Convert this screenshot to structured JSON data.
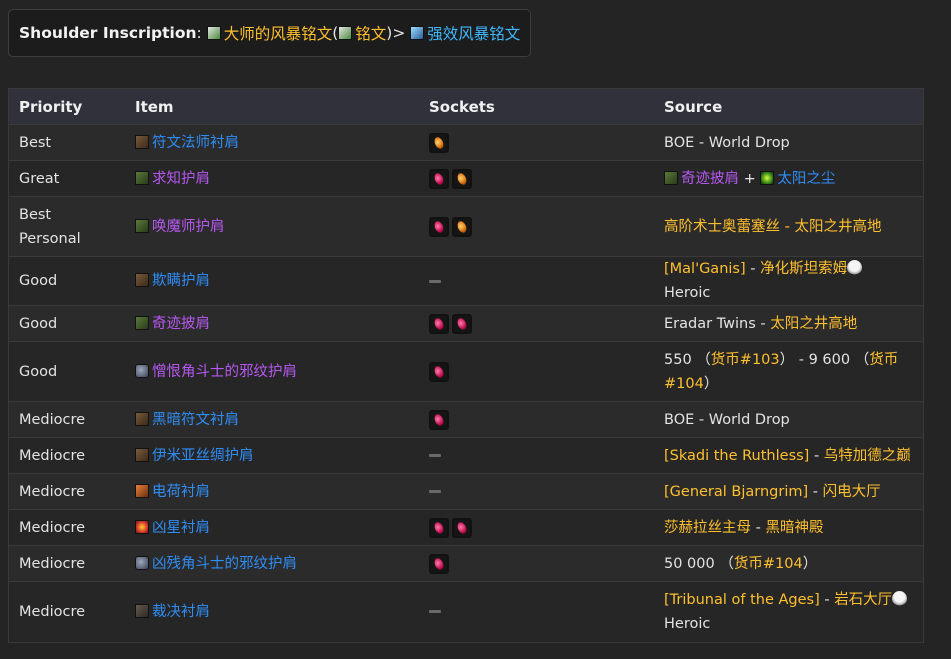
{
  "inscription": {
    "label": "Shoulder Inscription",
    "colon": ":",
    "master_name": "大师的风暴铭文",
    "paren_open": " (",
    "alt_name": "铭文",
    "paren_close": ") ",
    "arrow": ">",
    "upgrade_name": "强效风暴铭文"
  },
  "table": {
    "headers": [
      "Priority",
      "Item",
      "Sockets",
      "Source"
    ],
    "rows": [
      {
        "priority": "Best",
        "item": "符文法师衬肩",
        "item_color": "blue",
        "icon": "shoulder",
        "sockets": [
          "orange"
        ],
        "source": [
          {
            "t": "BOE - World Drop",
            "c": "white"
          }
        ]
      },
      {
        "priority": "Great",
        "item": "求知护肩",
        "item_color": "purple",
        "icon": "shoulder-green",
        "sockets": [
          "red",
          "orange"
        ],
        "source": [
          {
            "t": "奇迹披肩",
            "c": "purple",
            "icon": "shoulder-green"
          },
          {
            "t": " + ",
            "c": "white"
          },
          {
            "t": "太阳之尘",
            "c": "blue",
            "icon": "dust"
          }
        ]
      },
      {
        "priority": "Best Personal",
        "item": "唤魔师护肩",
        "item_color": "purple",
        "icon": "shoulder-green",
        "sockets": [
          "red",
          "orange"
        ],
        "source": [
          {
            "t": "高阶术士奥蕾塞丝 - 太阳之井高地",
            "c": "gold"
          }
        ]
      },
      {
        "priority": "Good",
        "item": "欺瞒护肩",
        "item_color": "blue",
        "icon": "shoulder",
        "sockets": [],
        "source": [
          {
            "t": "[Mal'Ganis]",
            "c": "gold"
          },
          {
            "t": " - ",
            "c": "white"
          },
          {
            "t": "净化斯坦索姆",
            "c": "gold"
          },
          {
            "t": " Heroic",
            "c": "white",
            "icon": "skull"
          }
        ]
      },
      {
        "priority": "Good",
        "item": "奇迹披肩",
        "item_color": "purple",
        "icon": "shoulder-green",
        "sockets": [
          "red",
          "red"
        ],
        "source": [
          {
            "t": "Eradar Twins",
            "c": "white"
          },
          {
            "t": " - ",
            "c": "white"
          },
          {
            "t": "太阳之井高地",
            "c": "gold"
          }
        ]
      },
      {
        "priority": "Good",
        "item": "憎恨角斗士的邪纹护肩",
        "item_color": "purple",
        "icon": "shoulder-felhorn",
        "sockets": [
          "red"
        ],
        "source": [
          {
            "t": "550 （",
            "c": "white"
          },
          {
            "t": "货币#103",
            "c": "gold"
          },
          {
            "t": "） - 9 600 （",
            "c": "white"
          },
          {
            "t": "货币#104",
            "c": "gold"
          },
          {
            "t": "）",
            "c": "white"
          }
        ]
      },
      {
        "priority": "Mediocre",
        "item": "黑暗符文衬肩",
        "item_color": "blue",
        "icon": "shoulder",
        "sockets": [
          "red"
        ],
        "source": [
          {
            "t": "BOE - World Drop",
            "c": "white"
          }
        ]
      },
      {
        "priority": "Mediocre",
        "item": "伊米亚丝绸护肩",
        "item_color": "blue",
        "icon": "shoulder",
        "sockets": [],
        "source": [
          {
            "t": "[Skadi the Ruthless]",
            "c": "gold"
          },
          {
            "t": " - ",
            "c": "white"
          },
          {
            "t": "乌特加德之巅",
            "c": "gold"
          }
        ]
      },
      {
        "priority": "Mediocre",
        "item": "电荷衬肩",
        "item_color": "blue",
        "icon": "shoulder-orange",
        "sockets": [],
        "source": [
          {
            "t": "[General Bjarngrim]",
            "c": "gold"
          },
          {
            "t": " - ",
            "c": "white"
          },
          {
            "t": "闪电大厅",
            "c": "gold"
          }
        ]
      },
      {
        "priority": "Mediocre",
        "item": "凶星衬肩",
        "item_color": "blue",
        "icon": "shoulder-fire",
        "sockets": [
          "red",
          "red"
        ],
        "source": [
          {
            "t": "莎赫拉丝主母",
            "c": "gold"
          },
          {
            "t": " - ",
            "c": "white"
          },
          {
            "t": "黑暗神殿",
            "c": "gold"
          }
        ]
      },
      {
        "priority": "Mediocre",
        "item": "凶残角斗士的邪纹护肩",
        "item_color": "blue",
        "icon": "shoulder-felhorn",
        "sockets": [
          "red"
        ],
        "source": [
          {
            "t": "50 000 （",
            "c": "white"
          },
          {
            "t": "货币#104",
            "c": "gold"
          },
          {
            "t": "）",
            "c": "white"
          }
        ]
      },
      {
        "priority": "Mediocre",
        "item": "裁决衬肩",
        "item_color": "blue",
        "icon": "shoulder-dark",
        "sockets": [],
        "source": [
          {
            "t": "[Tribunal of the Ages]",
            "c": "gold"
          },
          {
            "t": " - ",
            "c": "white"
          },
          {
            "t": "岩石大厅",
            "c": "gold"
          },
          {
            "t": " Heroic",
            "c": "white",
            "icon": "skull"
          }
        ]
      }
    ]
  }
}
